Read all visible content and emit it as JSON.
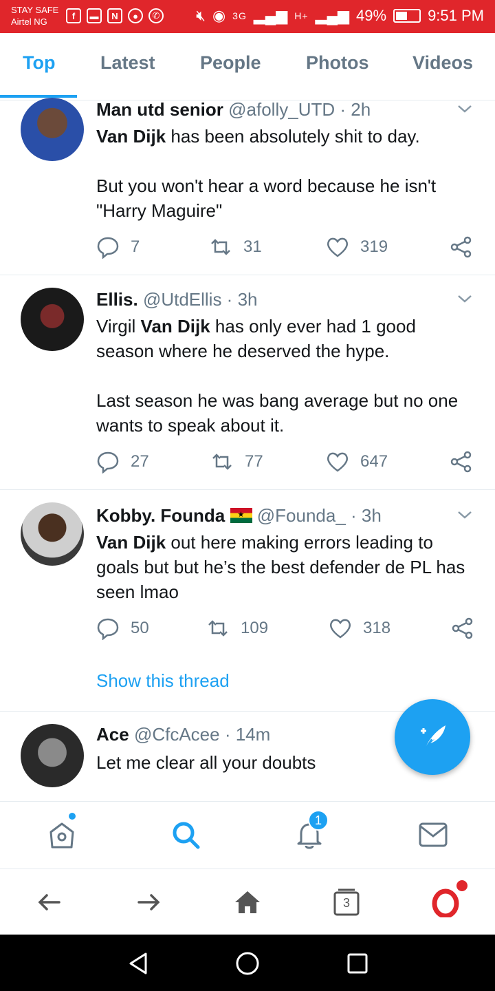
{
  "status_bar": {
    "line1": "STAY SAFE",
    "line2": "Airtel NG",
    "network": "3G",
    "network2": "H+",
    "battery": "49%",
    "time": "9:51 PM"
  },
  "tabs": [
    {
      "label": "Top",
      "active": true
    },
    {
      "label": "Latest"
    },
    {
      "label": "People"
    },
    {
      "label": "Photos"
    },
    {
      "label": "Videos"
    }
  ],
  "tweets": [
    {
      "name": "Man utd senior",
      "handle": "@afolly_UTD · 2h",
      "text_bold": "Van Dijk",
      "text_rest": " has been absolutely shit to day.",
      "text_para2": "But you won't hear a word because he isn't \"Harry Maguire\"",
      "replies": "7",
      "retweets": "31",
      "likes": "319"
    },
    {
      "name": "Ellis.",
      "handle": "@UtdEllis · 3h",
      "text_pre": "Virgil ",
      "text_bold": "Van Dijk",
      "text_rest": " has only ever had 1 good season where he deserved the hype.",
      "text_para2": "Last season he was bang average but no one wants to speak about it.",
      "replies": "27",
      "retweets": "77",
      "likes": "647"
    },
    {
      "name": "Kobby. Founda",
      "handle": "@Founda_ · 3h",
      "text_bold": "Van Dijk",
      "text_rest": " out here making errors leading to goals but but he’s the best defender de PL has seen lmao",
      "replies": "50",
      "retweets": "109",
      "likes": "318",
      "show_thread": "Show this thread"
    },
    {
      "name": "Ace",
      "handle": "@CfcAcee · 14m",
      "text": "Let me clear all your doubts"
    }
  ],
  "notifications_badge": "1",
  "tabs_count": "3",
  "colors": {
    "accent": "#1da1f2",
    "status_bar": "#e0262b",
    "muted": "#657786"
  }
}
